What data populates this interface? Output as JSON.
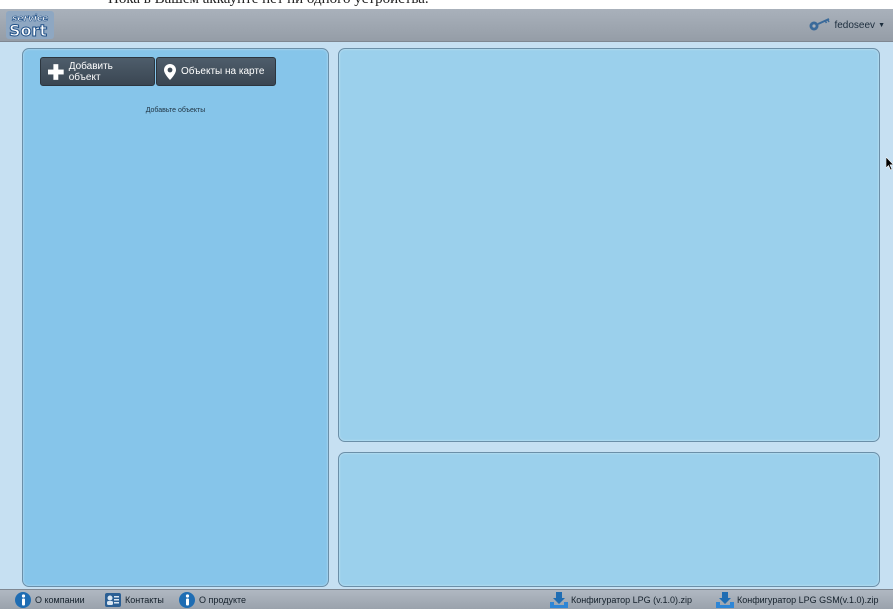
{
  "top_message": "Пока в Вашем аккаунте нет ни одного устройства.",
  "header": {
    "logo_text": "service Sort",
    "username": "fedoseev"
  },
  "left_panel": {
    "add_button_label": "Добавить объект",
    "map_button_label": "Объекты на карте",
    "empty_hint": "Добавьте объекты"
  },
  "footer": {
    "about_label": "О компании",
    "contacts_label": "Контакты",
    "product_label": "О продукте",
    "download1_label": "Конфигуратор LPG (v.1.0).zip",
    "download2_label": "Конфигуратор LPG GSM(v.1.0).zip"
  },
  "colors": {
    "accent_blue": "#1f6db3",
    "panel_left": "#86c5ea",
    "panel_right": "#9bd0ec"
  },
  "icons": [
    "plus-icon",
    "map-marker-icon",
    "info-icon",
    "contacts-icon",
    "download-icon",
    "key-icon"
  ]
}
